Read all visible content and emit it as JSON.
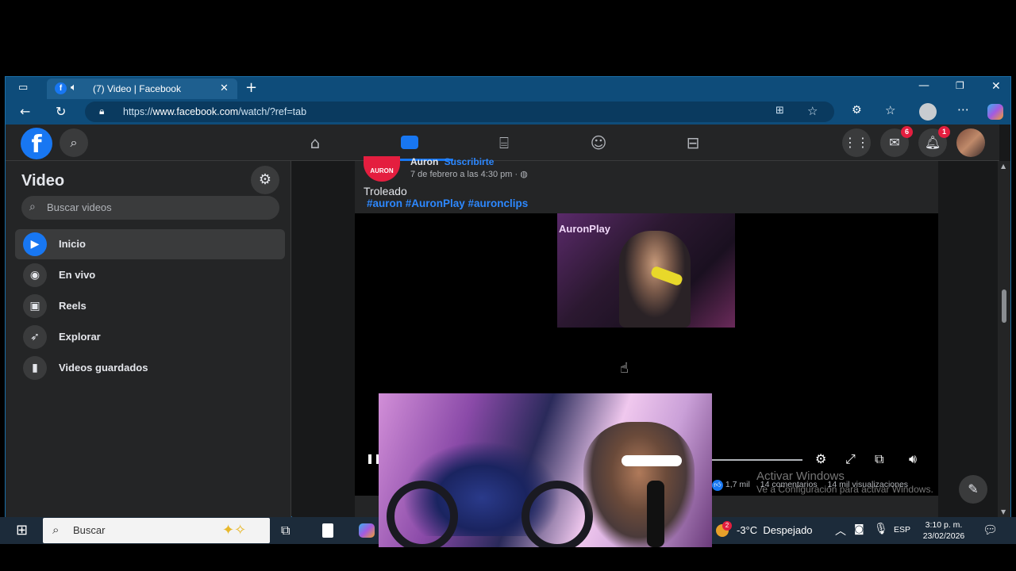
{
  "browser": {
    "tab_title": "(7) Video | Facebook",
    "url_prefix": "https://",
    "url_domain": "www.facebook.com",
    "url_path": "/watch/?ref=tab"
  },
  "fbnav": {
    "messenger_badge": "6",
    "notifications_badge": "1"
  },
  "sidebar": {
    "title": "Video",
    "search_placeholder": "Buscar videos",
    "items": [
      {
        "label": "Inicio",
        "icon": "video-play-icon",
        "active": true
      },
      {
        "label": "En vivo",
        "icon": "live-camera-icon",
        "active": false
      },
      {
        "label": "Reels",
        "icon": "reels-icon",
        "active": false
      },
      {
        "label": "Explorar",
        "icon": "rocket-icon",
        "active": false
      },
      {
        "label": "Videos guardados",
        "icon": "bookmark-icon",
        "active": false
      }
    ]
  },
  "post": {
    "author": "Auron",
    "subscribe": "Suscribirte",
    "avatar_text": "AURON",
    "date": "7 de febrero a las 4:30 pm ·",
    "text": "Troleado",
    "hashtags": "#auron #AuronPlay #auronclips",
    "video_overlay_text": "AuronPlay",
    "reactions": "1,7 mil",
    "comments": "14 comentarios",
    "views": "14 mil visualizaciones"
  },
  "watermark": {
    "line1": "Activar Windows",
    "line2": "Ve a Configuración para activar Windows."
  },
  "taskbar": {
    "search_placeholder": "Buscar",
    "weather": "-3°C  Despejado",
    "weather_badge": "2",
    "language": "ESP",
    "time": "3:10 p. m.",
    "date": "23/02/2026"
  }
}
